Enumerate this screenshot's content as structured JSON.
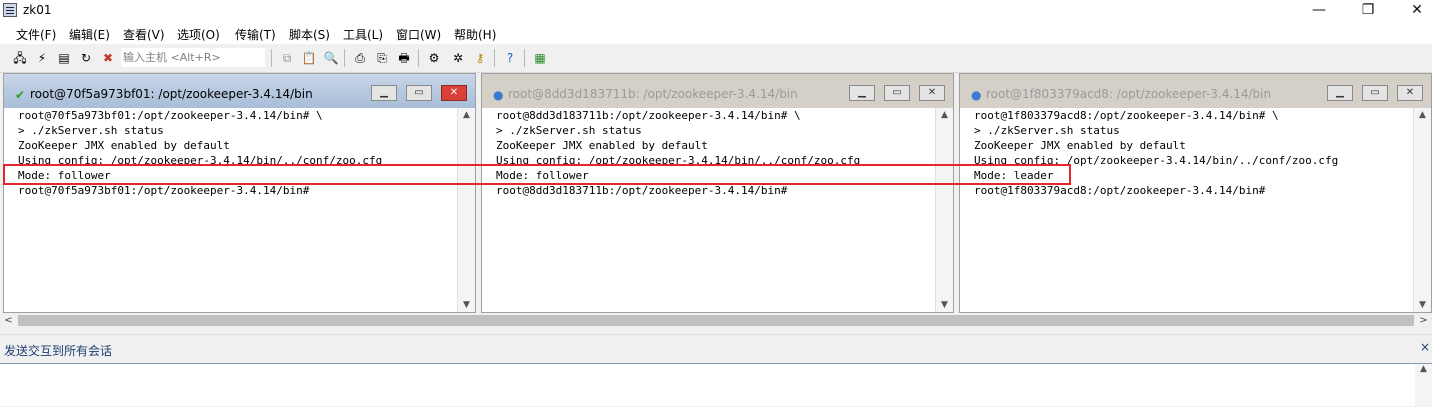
{
  "window": {
    "title": "zk01",
    "minimize": "—",
    "restore": "❐",
    "close": "✕"
  },
  "menu": [
    {
      "label": "文件(F)"
    },
    {
      "label": "编辑(E)"
    },
    {
      "label": "查看(V)"
    },
    {
      "label": "选项(O)"
    },
    {
      "label": "传输(T)"
    },
    {
      "label": "脚本(S)"
    },
    {
      "label": "工具(L)"
    },
    {
      "label": "窗口(W)"
    },
    {
      "label": "帮助(H)"
    }
  ],
  "toolbar": {
    "host_placeholder": "输入主机 <Alt+R>",
    "icons": [
      "connect-icon",
      "quick-connect-icon",
      "connect-tab-icon",
      "reconnect-icon",
      "disconnect-icon",
      "copy-icon",
      "paste-icon",
      "find-icon",
      "print-icon",
      "print-setup-icon",
      "printer-icon",
      "session-options-icon",
      "global-options-icon",
      "key-agent-icon",
      "help-icon",
      "sftp-icon"
    ]
  },
  "sessions": [
    {
      "title": "root@70f5a973bf01: /opt/zookeeper-3.4.14/bin",
      "status_icon": "connected-check-icon",
      "active": true,
      "lines": [
        "root@70f5a973bf01:/opt/zookeeper-3.4.14/bin# \\",
        "> ./zkServer.sh status",
        "ZooKeeper JMX enabled by default",
        "Using config: /opt/zookeeper-3.4.14/bin/../conf/zoo.cfg",
        "Mode: follower",
        "root@70f5a973bf01:/opt/zookeeper-3.4.14/bin#"
      ]
    },
    {
      "title": "root@8dd3d183711b: /opt/zookeeper-3.4.14/bin",
      "status_icon": "info-icon",
      "active": false,
      "lines": [
        "root@8dd3d183711b:/opt/zookeeper-3.4.14/bin# \\",
        "> ./zkServer.sh status",
        "ZooKeeper JMX enabled by default",
        "Using config: /opt/zookeeper-3.4.14/bin/../conf/zoo.cfg",
        "Mode: follower",
        "root@8dd3d183711b:/opt/zookeeper-3.4.14/bin#"
      ]
    },
    {
      "title": "root@1f803379acd8: /opt/zookeeper-3.4.14/bin",
      "status_icon": "info-icon",
      "active": false,
      "lines": [
        "root@1f803379acd8:/opt/zookeeper-3.4.14/bin# \\",
        "> ./zkServer.sh status",
        "ZooKeeper JMX enabled by default",
        "Using config: /opt/zookeeper-3.4.14/bin/../conf/zoo.cfg",
        "Mode: leader",
        "root@1f803379acd8:/opt/zookeeper-3.4.14/bin#"
      ]
    }
  ],
  "pane_buttons": {
    "minimize": "▁",
    "restore": "▭",
    "close": "✕"
  },
  "compose": {
    "label": "发送交互到所有会话",
    "close": "×"
  },
  "colors": {
    "highlight": "#e8242c",
    "active_title": "#a8bdd8",
    "compose_label": "#1e3f74"
  }
}
